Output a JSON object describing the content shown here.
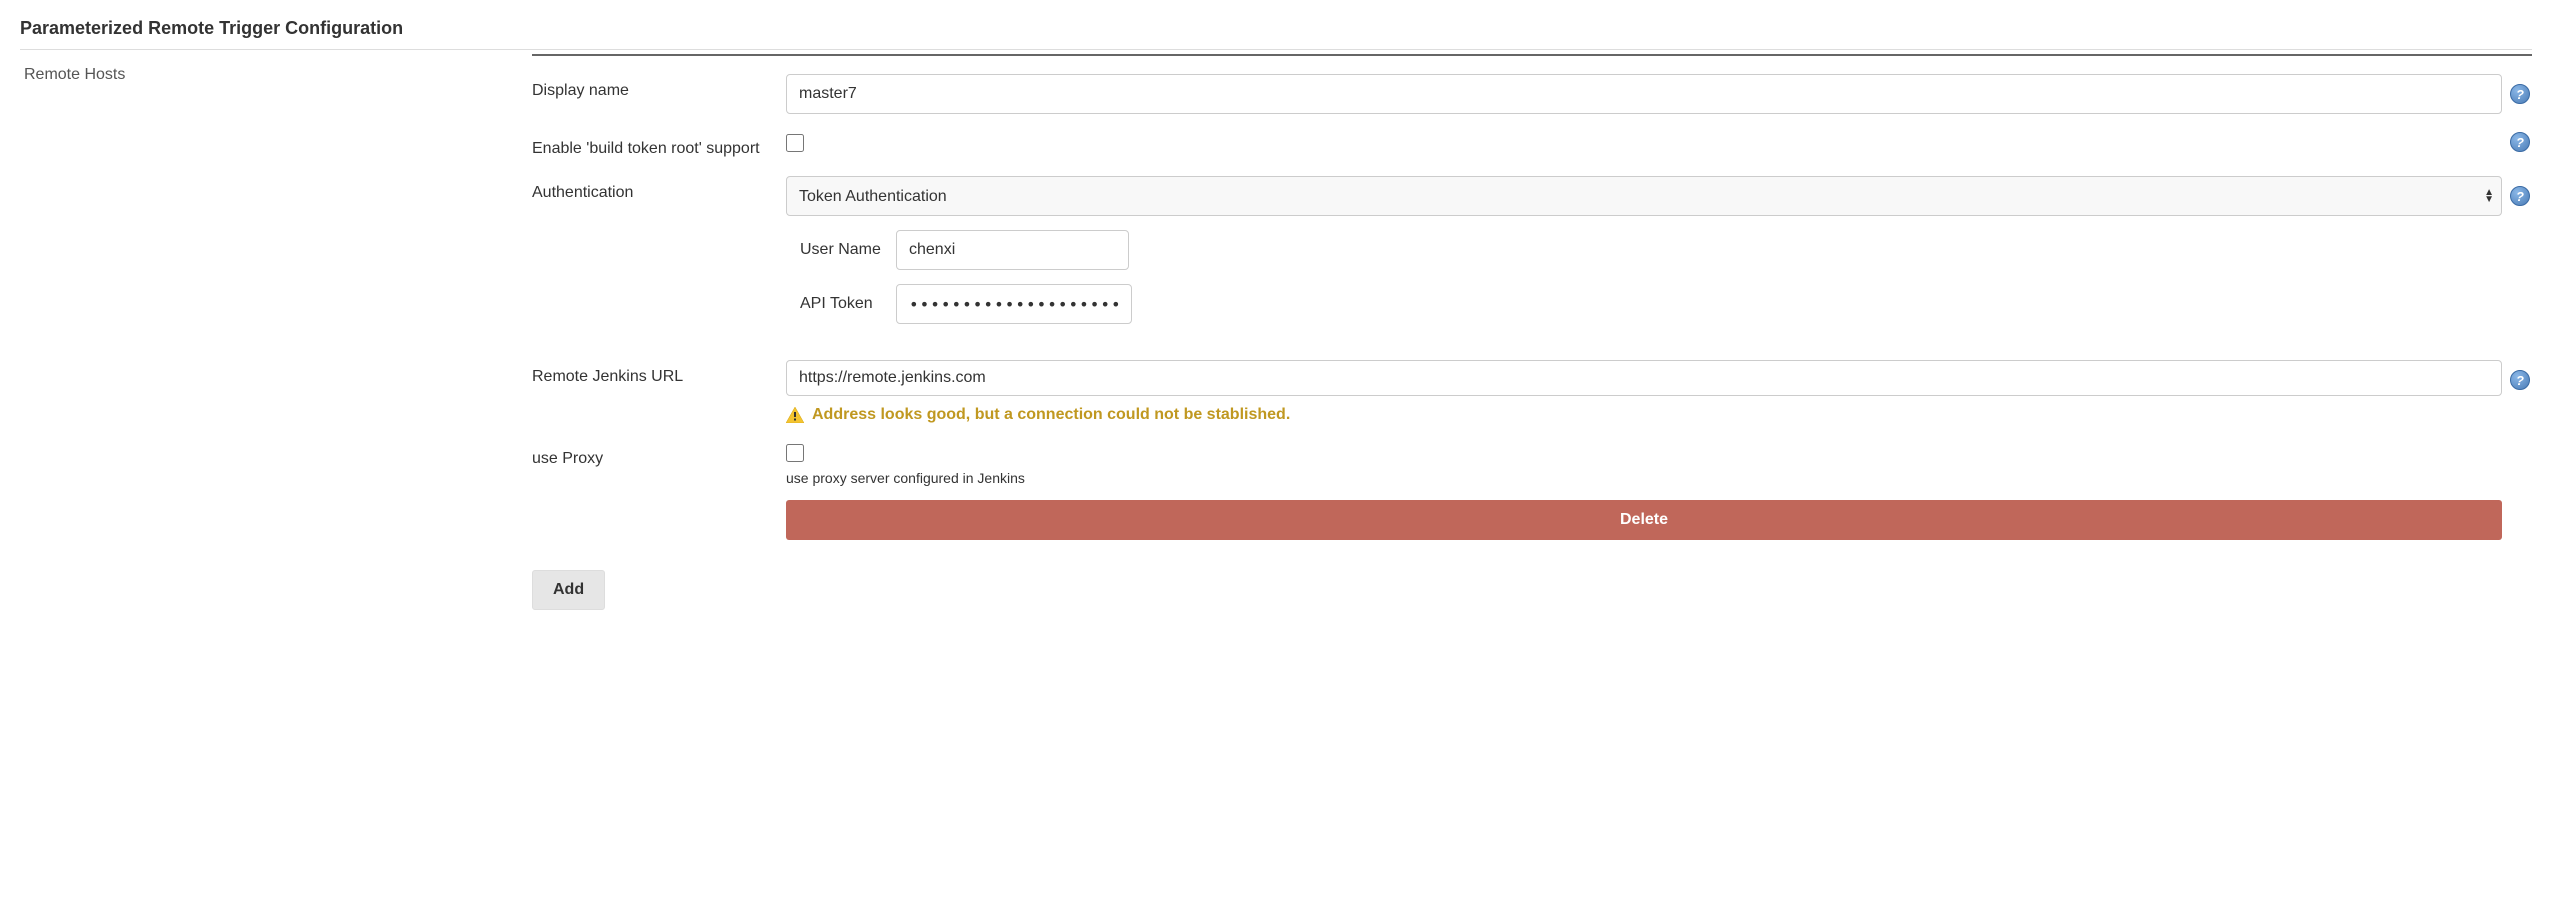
{
  "section": {
    "title": "Parameterized Remote Trigger Configuration",
    "subsection": "Remote Hosts"
  },
  "fields": {
    "display_name": {
      "label": "Display name",
      "value": "master7"
    },
    "build_token_root": {
      "label": "Enable 'build token root' support"
    },
    "authentication": {
      "label": "Authentication",
      "selected": "Token Authentication"
    },
    "user_name": {
      "label": "User Name",
      "value": "chenxi"
    },
    "api_token": {
      "label": "API Token",
      "value": "••••••••••••••••••••••••••••"
    },
    "remote_url": {
      "label": "Remote Jenkins URL",
      "value": "https://remote.jenkins.com",
      "validation": "Address looks good, but a connection could not be stablished."
    },
    "use_proxy": {
      "label": "use Proxy",
      "hint": "use proxy server configured in Jenkins"
    }
  },
  "buttons": {
    "delete": "Delete",
    "add": "Add"
  },
  "help_glyph": "?"
}
